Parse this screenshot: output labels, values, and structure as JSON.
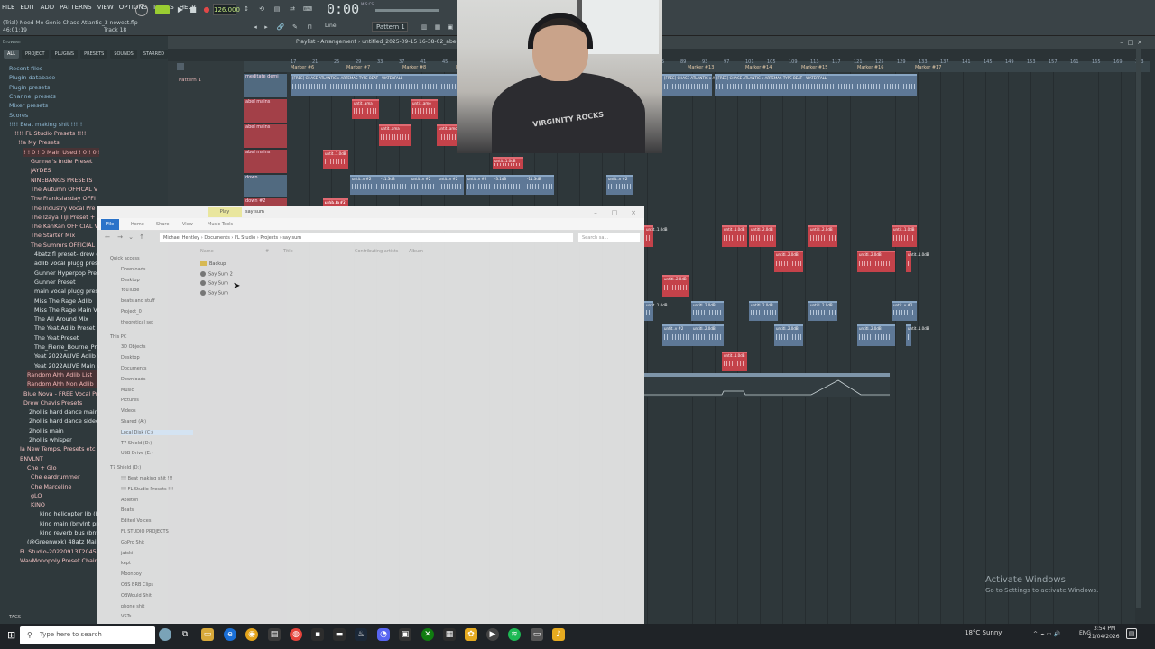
{
  "menu": [
    "FILE",
    "EDIT",
    "ADD",
    "PATTERNS",
    "VIEW",
    "OPTIONS",
    "TOOLS",
    "HELP"
  ],
  "project_title": "(Trial) Need Me Genie Chase Atlantic_3 newest.flp",
  "project_info": "46:01:19",
  "track_label": "Track 18",
  "tempo": "126.000",
  "time": "0:00",
  "time_label": "M:S:CS",
  "pattern_selector": "Pattern 1",
  "snap": "Line",
  "browser": {
    "title": "Browser",
    "tabs": [
      "ALL",
      "PROJECT",
      "PLUGINS",
      "PRESETS",
      "SOUNDS",
      "STARRED"
    ],
    "items": [
      {
        "label": "Recent files",
        "style": "blue"
      },
      {
        "label": "Plugin database",
        "style": "blue"
      },
      {
        "label": "Plugin presets",
        "style": "blue"
      },
      {
        "label": "Channel presets",
        "style": "blue"
      },
      {
        "label": "Mixer presets",
        "style": "blue"
      },
      {
        "label": "Scores",
        "style": "blue"
      },
      {
        "label": "!!!!  Beat making shit  !!!!!",
        "style": "blue"
      },
      {
        "label": "!!!!  FL Studio Presets  !!!!",
        "style": "pink"
      },
      {
        "label": "!!a My Presets",
        "style": "pink"
      },
      {
        "label": "! ! 0 ! 0 Main Used ! 0 ! 0 !",
        "style": "red"
      },
      {
        "label": "Gunner's Indie Preset",
        "style": "pink"
      },
      {
        "label": "JAYDES",
        "style": "pink"
      },
      {
        "label": "NINEBANGS PRESETS",
        "style": "pink"
      },
      {
        "label": "The Autumn OFFICAL V",
        "style": "pink"
      },
      {
        "label": "The Frankslasday OFFI",
        "style": "pink"
      },
      {
        "label": "The Industry Vocal Pre",
        "style": "pink"
      },
      {
        "label": "The Izaya Tiji Preset +",
        "style": "pink"
      },
      {
        "label": "The KanKan OFFICIAL V",
        "style": "pink"
      },
      {
        "label": "The Starter Mix",
        "style": "pink"
      },
      {
        "label": "The Summrs OFFICIAL",
        "style": "pink"
      },
      {
        "label": "4batz fl preset- drew ch",
        "style": "white"
      },
      {
        "label": "adlib vocal plugg preset",
        "style": "white"
      },
      {
        "label": "Gunner Hyperpop Preset",
        "style": "white"
      },
      {
        "label": "Gunner Preset",
        "style": "white"
      },
      {
        "label": "main vocal plugg preset",
        "style": "white"
      },
      {
        "label": "Miss The Rage Adlib",
        "style": "white"
      },
      {
        "label": "Miss The Rage Main Voc",
        "style": "white"
      },
      {
        "label": "The All Around Mix",
        "style": "white"
      },
      {
        "label": "The Yeat Adlib Preset",
        "style": "white"
      },
      {
        "label": "The Yeat Preset",
        "style": "white"
      },
      {
        "label": "The_Pierre_Bourne_Prese",
        "style": "white"
      },
      {
        "label": "Yeat 2022ALIVE Adlib Vo",
        "style": "white"
      },
      {
        "label": "Yeat 2022ALIVE Main Voc",
        "style": "white"
      },
      {
        "label": "Random Ahh Adlib List",
        "style": "red"
      },
      {
        "label": "Random Ahh Non Adlib",
        "style": "red"
      },
      {
        "label": "Blue Nova - FREE Vocal Pre",
        "style": "pink"
      },
      {
        "label": "Drew Chavis Presets",
        "style": "pink"
      },
      {
        "label": "2hollis hard dance main_",
        "style": "white"
      },
      {
        "label": "2hollis hard dance sidecha",
        "style": "white"
      },
      {
        "label": "2hollis main",
        "style": "white"
      },
      {
        "label": "2hollis whisper",
        "style": "white"
      },
      {
        "label": "Ia New Temps, Presets etc",
        "style": "pink"
      },
      {
        "label": "BNVLNT",
        "style": "pink"
      },
      {
        "label": "Che + Glo",
        "style": "pink"
      },
      {
        "label": "Che eardrummer",
        "style": "pink"
      },
      {
        "label": "Che Marceline",
        "style": "pink"
      },
      {
        "label": "gLO",
        "style": "pink"
      },
      {
        "label": "KINO",
        "style": "pink"
      },
      {
        "label": "kino helicopter lib (bv",
        "style": "white"
      },
      {
        "label": "kino main (bnvlnt pre",
        "style": "white"
      },
      {
        "label": "kino reverb bus (bnvl",
        "style": "white"
      },
      {
        "label": "(@Greenwxk) 48atz Main",
        "style": "white"
      },
      {
        "label": "FL Studio-20220913T20450",
        "style": "pink"
      },
      {
        "label": "WavMonopoly Preset Chain",
        "style": "pink"
      }
    ],
    "tags": "TAGS"
  },
  "pattern_list": [
    "Pattern 1"
  ],
  "playlist": {
    "title": "Playlist - Arrangement › untitled_2025-09-15 16-38-02_abel",
    "markers": [
      "Marker #6",
      "Marker #7",
      "Marker #8",
      "Marker #9",
      "Marker #13",
      "Marker #14",
      "Marker #15",
      "Marker #16",
      "Marker #17"
    ],
    "bar_numbers": [
      "17",
      "21",
      "25",
      "29",
      "33",
      "37",
      "41",
      "45",
      "49",
      "53",
      "57",
      "61",
      "65",
      "69",
      "73",
      "77",
      "81",
      "85",
      "89",
      "93",
      "97",
      "101",
      "105",
      "109",
      "113",
      "117",
      "121",
      "125",
      "129",
      "133",
      "137",
      "141",
      "145",
      "149",
      "153",
      "157",
      "161",
      "165",
      "169",
      "173"
    ],
    "tracks": [
      {
        "label": "meditate demi",
        "style": "blue"
      },
      {
        "label": "abel mains",
        "style": "red"
      },
      {
        "label": "abel mains",
        "style": "red"
      },
      {
        "label": "abel mains",
        "style": "red"
      },
      {
        "label": "down",
        "style": "blue"
      },
      {
        "label": "down #2",
        "style": "red"
      }
    ],
    "clip_labels": [
      "[FREE] CHASE ATLANTIC x ARTEMAS TYPE BEAT - WATERFALL",
      "[FREE] CHASE ATLANTIC x ARTEMAS TYPE BEAT - WATERFALL",
      "untit..ama",
      "untit..amo",
      "untit..1.0dB",
      "untit..v #2",
      "-11.3dB",
      "-3.1dB",
      "untitl..2.0dB",
      "untit..tz #2"
    ]
  },
  "explorer": {
    "title": "say sum",
    "play_tab": "Play",
    "ribbon_tabs": [
      "File",
      "Home",
      "Share",
      "View",
      "Music Tools"
    ],
    "address": [
      "Michael Hentley",
      "Documents",
      "FL Studio",
      "Projects",
      "say sum"
    ],
    "search_placeholder": "Search sa...",
    "columns": [
      "Name",
      "#",
      "Title",
      "Contributing artists",
      "Album"
    ],
    "nav": [
      {
        "label": "Quick access"
      },
      {
        "label": "Downloads"
      },
      {
        "label": "Desktop"
      },
      {
        "label": "YouTube"
      },
      {
        "label": "beats and stuff"
      },
      {
        "label": "Project_0"
      },
      {
        "label": "theoretical set"
      },
      {
        "label": "This PC"
      },
      {
        "label": "3D Objects"
      },
      {
        "label": "Desktop"
      },
      {
        "label": "Documents"
      },
      {
        "label": "Downloads"
      },
      {
        "label": "Music"
      },
      {
        "label": "Pictures"
      },
      {
        "label": "Videos"
      },
      {
        "label": "Shared (A:)"
      },
      {
        "label": "Local Disk (C:)"
      },
      {
        "label": "T7 Shield (D:)"
      },
      {
        "label": "USB Drive (E:)"
      },
      {
        "label": "T7 Shield (D:)"
      },
      {
        "label": "!!!  Beat making shit  !!!"
      },
      {
        "label": "!!!  FL Studio Presets  !!!"
      },
      {
        "label": "Ableton"
      },
      {
        "label": "Beats"
      },
      {
        "label": "Edited Voices"
      },
      {
        "label": "FL STUDIO PROJECTS"
      },
      {
        "label": "GoPro Shit"
      },
      {
        "label": "jatski"
      },
      {
        "label": "kept"
      },
      {
        "label": "Moonboy"
      },
      {
        "label": "OBS BRB Clips"
      },
      {
        "label": "OBWould Shit"
      },
      {
        "label": "phone shit"
      },
      {
        "label": "VSTs"
      }
    ],
    "files": [
      {
        "label": "Backup",
        "kind": "folder"
      },
      {
        "label": "Say Sum 2",
        "kind": "flp"
      },
      {
        "label": "Say Sum",
        "kind": "flp"
      },
      {
        "label": "Say Sum",
        "kind": "flp"
      }
    ]
  },
  "webcam": {
    "hoodie_text": "VIRGINITY ROCKS"
  },
  "activate": {
    "line1": "Activate Windows",
    "line2": "Go to Settings to activate Windows."
  },
  "taskbar": {
    "search_placeholder": "Type here to search",
    "weather": "18°C  Sunny",
    "lang": "ENG",
    "time": "3:54 PM",
    "date": "21/04/2026"
  },
  "colors": {
    "accent_red": "#c4424a",
    "accent_blue": "#5e7896",
    "tempo_green": "#bfe37d"
  }
}
